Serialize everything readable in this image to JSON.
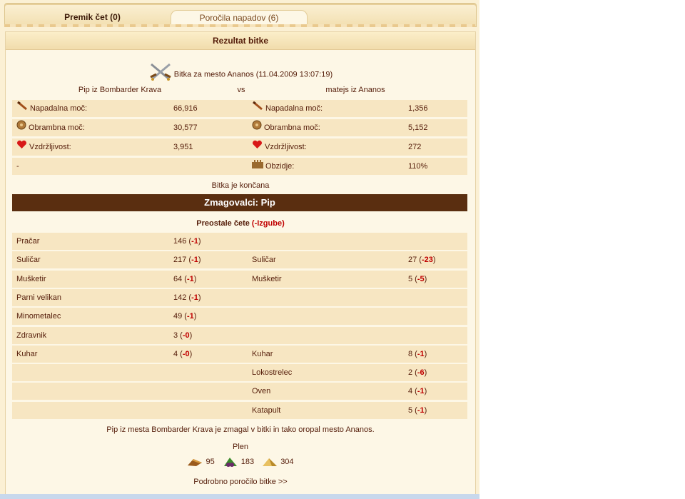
{
  "tabs": [
    {
      "label": "Premik čet (0)"
    },
    {
      "label": "Poročila napadov (6)"
    }
  ],
  "section_title": "Rezultat bitke",
  "battle": {
    "title": "Bitka za mesto Ananos (11.04.2009 13:07:19)",
    "attacker": "Pip iz Bombarder Krava",
    "vs": "vs",
    "defender": "matejs iz Ananos"
  },
  "stats": {
    "attacker": [
      {
        "icon": "sword-icon",
        "label": "Napadalna moč:",
        "value": "66,916"
      },
      {
        "icon": "shield-icon",
        "label": "Obrambna moč:",
        "value": "30,577"
      },
      {
        "icon": "heart-icon",
        "label": "Vzdržljivost:",
        "value": "3,951"
      },
      {
        "icon": "",
        "label": "-",
        "value": ""
      }
    ],
    "defender": [
      {
        "icon": "sword-icon",
        "label": "Napadalna moč:",
        "value": "1,356"
      },
      {
        "icon": "shield-icon",
        "label": "Obrambna moč:",
        "value": "5,152"
      },
      {
        "icon": "heart-icon",
        "label": "Vzdržljivost:",
        "value": "272"
      },
      {
        "icon": "wall-icon",
        "label": "Obzidje:",
        "value": "110%"
      }
    ]
  },
  "status": "Bitka je končana",
  "winner": "Zmagovalci: Pip",
  "remaining": {
    "title": "Preostale čete",
    "losses_label": "(-Izgube)"
  },
  "units": [
    {
      "a_name": "Pračar",
      "a_count": "146",
      "a_loss": "-1",
      "d_name": "",
      "d_count": "",
      "d_loss": ""
    },
    {
      "a_name": "Suličar",
      "a_count": "217",
      "a_loss": "-1",
      "d_name": "Suličar",
      "d_count": "27",
      "d_loss": "-23"
    },
    {
      "a_name": "Mušketir",
      "a_count": "64",
      "a_loss": "-1",
      "d_name": "Mušketir",
      "d_count": "5",
      "d_loss": "-5"
    },
    {
      "a_name": "Parni velikan",
      "a_count": "142",
      "a_loss": "-1",
      "d_name": "",
      "d_count": "",
      "d_loss": ""
    },
    {
      "a_name": "Minometalec",
      "a_count": "49",
      "a_loss": "-1",
      "d_name": "",
      "d_count": "",
      "d_loss": ""
    },
    {
      "a_name": "Zdravnik",
      "a_count": "3",
      "a_loss": "-0",
      "d_name": "",
      "d_count": "",
      "d_loss": ""
    },
    {
      "a_name": "Kuhar",
      "a_count": "4",
      "a_loss": "-0",
      "d_name": "Kuhar",
      "d_count": "8",
      "d_loss": "-1"
    },
    {
      "a_name": "",
      "a_count": "",
      "a_loss": "",
      "d_name": "Lokostrelec",
      "d_count": "2",
      "d_loss": "-6"
    },
    {
      "a_name": "",
      "a_count": "",
      "a_loss": "",
      "d_name": "Oven",
      "d_count": "4",
      "d_loss": "-1"
    },
    {
      "a_name": "",
      "a_count": "",
      "a_loss": "",
      "d_name": "Katapult",
      "d_count": "5",
      "d_loss": "-1"
    }
  ],
  "outcome": "Pip iz mesta Bombarder Krava je zmagal v bitki in tako oropal mesto Ananos.",
  "plunder": {
    "label": "Plen",
    "items": [
      {
        "icon": "wood-icon",
        "value": "95"
      },
      {
        "icon": "wine-icon",
        "value": "183"
      },
      {
        "icon": "marble-icon",
        "value": "304"
      }
    ]
  },
  "detail_link": "Podrobno poročilo bitke >>"
}
